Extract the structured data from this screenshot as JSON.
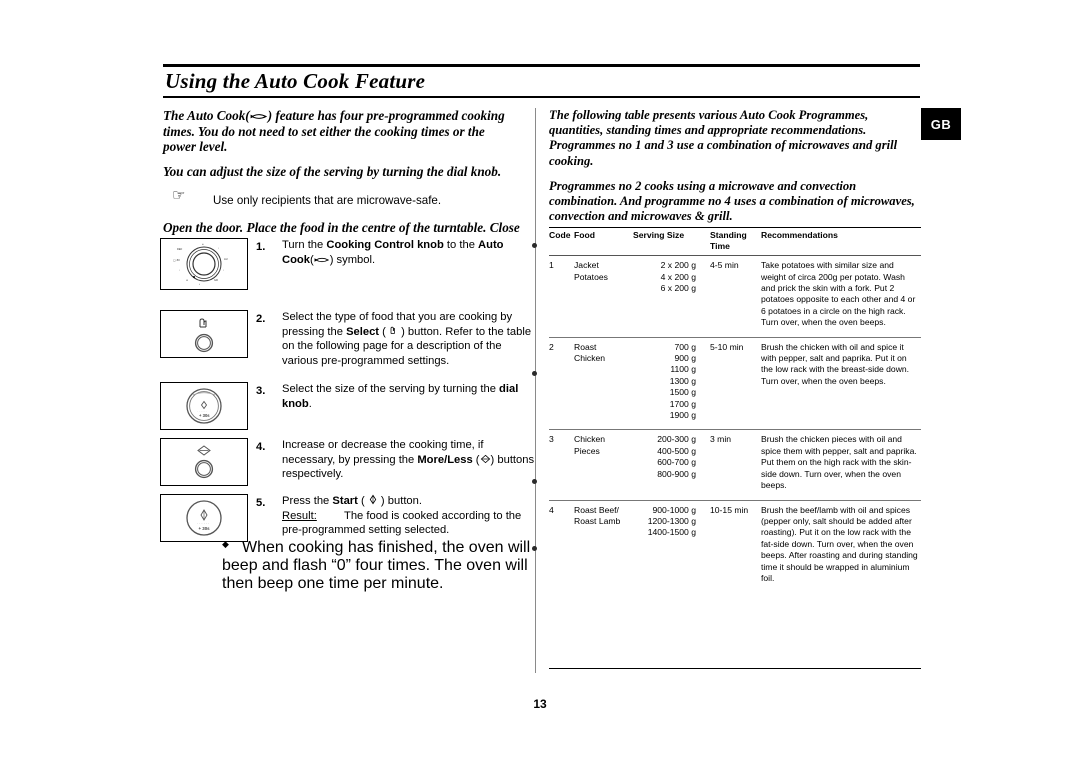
{
  "document": {
    "title": "Using the Auto Cook Feature",
    "page_number": "13",
    "region_badge": "GB"
  },
  "left_column": {
    "intro_paragraph_1": "The Auto Cook(  ) feature has four pre-programmed cooking times. You do not need to set either the cooking times or the power level.",
    "intro_paragraph_2": "You can adjust the size of the serving by turning the dial knob.",
    "hand_note": "Use only recipients that are microwave-safe.",
    "intro_paragraph_3": "Open the door. Place the food in the centre of the turntable. Close the door.",
    "steps": [
      {
        "number": "1.",
        "figure": "cooking-control-knob-dial",
        "text_html": "Turn the <b>Cooking Control knob</b> to the <b>Auto Cook</b>(  ) symbol."
      },
      {
        "number": "2.",
        "figure": "select-button",
        "text_html": "Select the type of food that you are cooking by pressing the <b>Select</b> (  ) button. Refer to the table on the following page for a description of the various pre-programmed settings."
      },
      {
        "number": "3.",
        "figure": "dial-knob",
        "text_html": "Select the size of the serving by turning the <b>dial knob</b>."
      },
      {
        "number": "4.",
        "figure": "more-less-button",
        "text_html": "Increase or decrease the cooking time, if necessary, by pressing the <b>More/Less</b> (  ) buttons respectively."
      },
      {
        "number": "5.",
        "figure": "start-button",
        "text_html": "Press the <b>Start</b> (  ) button."
      }
    ],
    "result": {
      "label": "Result:",
      "text": "The food is cooked according to the pre-programmed setting selected.",
      "bullet": "◆",
      "bullet_text": "When cooking has finished, the oven will beep and flash “0” four times. The oven will then beep one time per minute."
    }
  },
  "right_column": {
    "paragraph_1": "The following table presents various Auto Cook Programmes, quantities, standing times and appropriate recommendations. Programmes no 1 and 3 use a combination of microwaves and grill cooking.",
    "paragraph_2": "Programmes no 2 cooks using a microwave and convection combination. And programme no 4 uses a combination of microwaves, convection and microwaves & grill.",
    "table": {
      "headers": [
        "Code",
        "Food",
        "Serving Size",
        "Standing Time",
        "Recommendations"
      ],
      "rows": [
        {
          "code": "1",
          "food": "Jacket\nPotatoes",
          "serving_size": "2 x 200 g\n4 x 200 g\n6 x 200 g",
          "standing_time": "4-5 min",
          "recommendations": "Take potatoes with similar size and weight of circa 200g per potato. Wash and prick the skin with a fork. Put 2 potatoes opposite to each other and 4 or 6 potatoes in a circle on the high rack. Turn over, when the oven beeps."
        },
        {
          "code": "2",
          "food": "Roast\nChicken",
          "serving_size": "700 g\n900 g\n1100 g\n1300 g\n1500 g\n1700 g\n1900 g",
          "standing_time": "5-10 min",
          "recommendations": "Brush the chicken with oil and spice it with pepper, salt and paprika. Put it on the low rack with the breast-side down. Turn over, when the oven beeps."
        },
        {
          "code": "3",
          "food": "Chicken\nPieces",
          "serving_size": "200-300 g\n400-500 g\n600-700 g\n800-900 g",
          "standing_time": "3 min",
          "recommendations": "Brush the chicken pieces with oil and spice them with pepper, salt and paprika. Put them on the high rack with the skin-side down. Turn over, when the oven beeps."
        },
        {
          "code": "4",
          "food": "Roast Beef/\nRoast Lamb",
          "serving_size": "900-1000 g\n1200-1300 g\n1400-1500 g",
          "standing_time": "10-15 min",
          "recommendations": "Brush the beef/lamb with oil and spices (pepper only, salt should be added after roasting). Put it on the low rack with the fat-side down. Turn over, when the oven beeps. After roasting and during standing time it should be wrapped in aluminium foil."
        }
      ]
    }
  }
}
